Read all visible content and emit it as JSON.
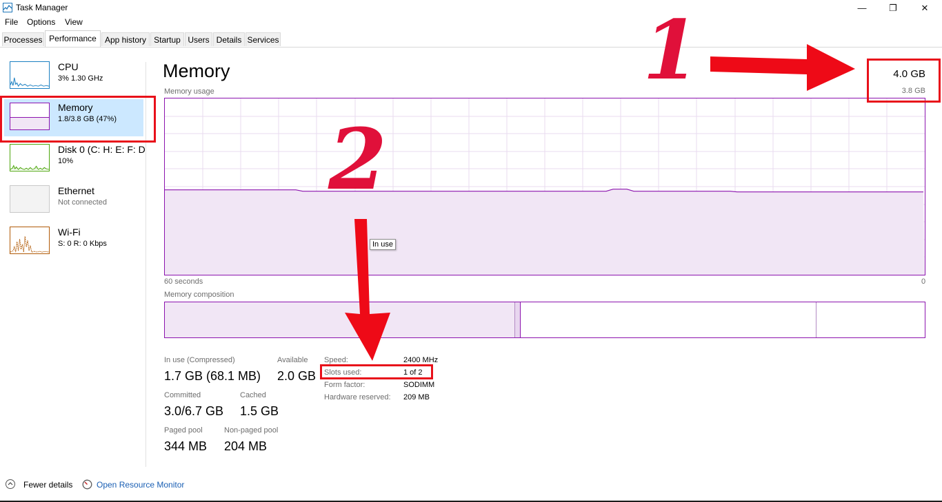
{
  "window": {
    "title": "Task Manager",
    "min_glyph": "—",
    "max_glyph": "❐",
    "close_glyph": "✕"
  },
  "menu": [
    "File",
    "Options",
    "View"
  ],
  "tabs": [
    "Processes",
    "Performance",
    "App history",
    "Startup",
    "Users",
    "Details",
    "Services"
  ],
  "active_tab": "Performance",
  "sidebar": [
    {
      "title": "CPU",
      "subtitle": "3%  1.30 GHz",
      "icon": "cpu-graph-thumbnail"
    },
    {
      "title": "Memory",
      "subtitle": "1.8/3.8 GB (47%)",
      "icon": "memory-graph-thumbnail",
      "selected": true
    },
    {
      "title": "Disk 0 (C: H: E: F: D",
      "subtitle": "10%",
      "icon": "disk-graph-thumbnail"
    },
    {
      "title": "Ethernet",
      "subtitle": "Not connected",
      "icon": "ethernet-graph-thumbnail"
    },
    {
      "title": "Wi-Fi",
      "subtitle": "S: 0  R: 0 Kbps",
      "icon": "wifi-graph-thumbnail"
    }
  ],
  "main": {
    "title": "Memory",
    "total": "4.0 GB",
    "usable": "3.8 GB",
    "usage_label": "Memory usage",
    "axis_left": "60 seconds",
    "axis_right": "0",
    "composition_label": "Memory composition",
    "tooltip": "In use",
    "in_use_fraction": 0.47,
    "stats": {
      "in_use_label": "In use (Compressed)",
      "in_use_value": "1.7 GB (68.1 MB)",
      "available_label": "Available",
      "available_value": "2.0 GB",
      "committed_label": "Committed",
      "committed_value": "3.0/6.7 GB",
      "cached_label": "Cached",
      "cached_value": "1.5 GB",
      "paged_label": "Paged pool",
      "paged_value": "344 MB",
      "nonpaged_label": "Non-paged pool",
      "nonpaged_value": "204 MB"
    },
    "details": [
      {
        "label": "Speed:",
        "value": "2400 MHz"
      },
      {
        "label": "Slots used:",
        "value": "1 of 2"
      },
      {
        "label": "Form factor:",
        "value": "SODIMM"
      },
      {
        "label": "Hardware reserved:",
        "value": "209 MB"
      }
    ]
  },
  "footer": {
    "fewer_details": "Fewer details",
    "open_monitor": "Open Resource Monitor"
  },
  "annotations": {
    "one": "1",
    "two": "2"
  },
  "colors": {
    "memory": "#8b12ae",
    "cpu": "#1a7fc1",
    "disk": "#4da60c",
    "wifi": "#b15a06",
    "annotation": "#e8101a",
    "selected": "#cce8ff"
  }
}
